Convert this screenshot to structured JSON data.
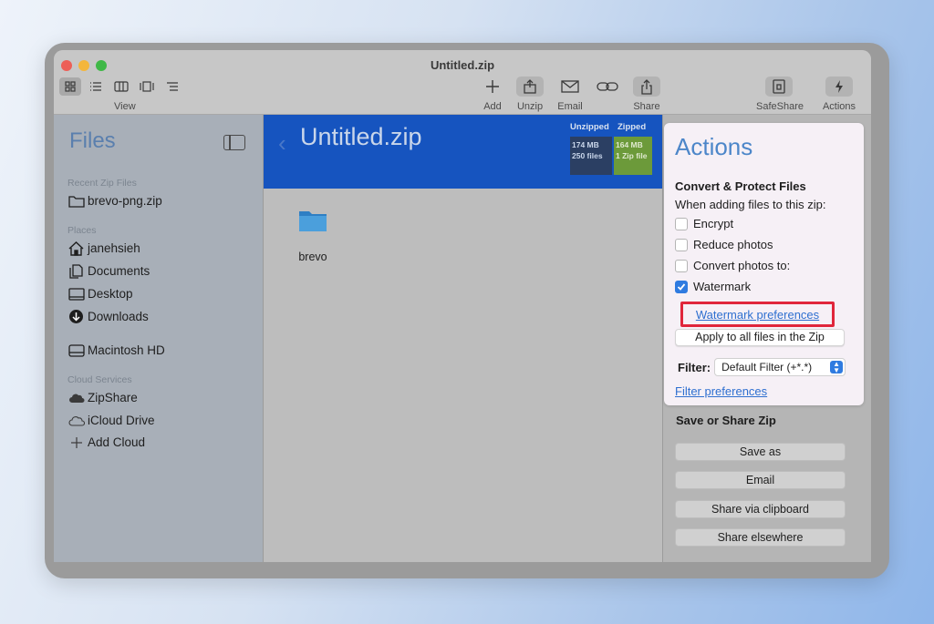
{
  "window": {
    "title": "Untitled.zip"
  },
  "toolbar": {
    "view_label": "View",
    "add_label": "Add",
    "unzip_label": "Unzip",
    "email_label": "Email",
    "share_label": "Share",
    "safeshare_label": "SafeShare",
    "actions_label": "Actions"
  },
  "sidebar": {
    "title": "Files",
    "recent_heading": "Recent Zip Files",
    "recent_items": [
      {
        "label": "brevo-png.zip",
        "icon": "folder-icon"
      }
    ],
    "places_heading": "Places",
    "places": [
      {
        "label": "janehsieh",
        "icon": "home-icon"
      },
      {
        "label": "Documents",
        "icon": "documents-icon"
      },
      {
        "label": "Desktop",
        "icon": "desktop-icon"
      },
      {
        "label": "Downloads",
        "icon": "downloads-icon"
      },
      {
        "label": "Macintosh HD",
        "icon": "disk-icon"
      }
    ],
    "cloud_heading": "Cloud Services",
    "cloud_items": [
      {
        "label": "ZipShare",
        "icon": "zipshare-icon"
      },
      {
        "label": "iCloud Drive",
        "icon": "icloud-icon"
      },
      {
        "label": "Add Cloud",
        "icon": "plus-icon"
      }
    ]
  },
  "main": {
    "zip_name": "Untitled.zip",
    "unzipped_heading": "Unzipped",
    "zipped_heading": "Zipped",
    "unzipped_size": "174 MB",
    "unzipped_count": "250 files",
    "zipped_size": "164 MB",
    "zipped_count": "1 Zip file",
    "items": [
      {
        "label": "brevo",
        "icon": "folder-icon"
      }
    ]
  },
  "actions": {
    "title": "Actions",
    "convert_heading": "Convert & Protect Files",
    "convert_sub": "When adding files to this zip:",
    "options": [
      {
        "label": "Encrypt",
        "checked": false
      },
      {
        "label": "Reduce photos",
        "checked": false
      },
      {
        "label": "Convert photos to:",
        "checked": false
      },
      {
        "label": "Watermark",
        "checked": true
      }
    ],
    "watermark_link": "Watermark preferences",
    "apply_button": "Apply to all files in the Zip",
    "filter_label": "Filter:",
    "filter_value": "Default Filter (+*.*)",
    "filter_link": "Filter preferences"
  },
  "save_share": {
    "heading": "Save or Share Zip",
    "buttons": [
      "Save as",
      "Email",
      "Share via clipboard",
      "Share elsewhere"
    ]
  },
  "colors": {
    "accent_blue": "#2f7be0",
    "banner_blue": "#1654bf",
    "highlight_red": "#e0263b",
    "zipped_green": "#8ab84a"
  }
}
